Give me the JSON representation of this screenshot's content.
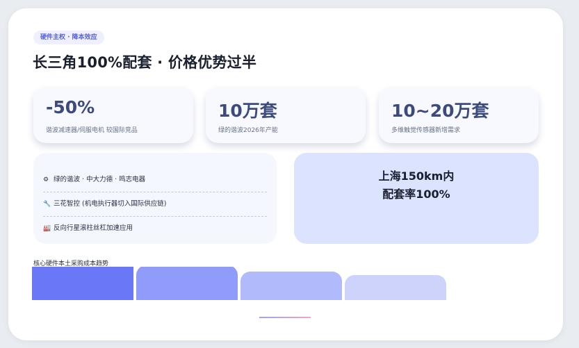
{
  "header": {
    "tag": "硬件主权 · 降本效应",
    "title": "长三角100%配套 · 价格优势过半"
  },
  "stats": [
    {
      "value": "-50%",
      "desc": "谐波减速器/伺服电机 较国际竞品"
    },
    {
      "value": "10万套",
      "desc": "绿的谐波2026年产能"
    },
    {
      "value": "10~20万套",
      "desc": "多维触觉传感器新增需求"
    }
  ],
  "bullets": [
    {
      "icon": "gear-icon",
      "glyph": "⚙",
      "text": "绿的谐波 · 中大力德 · 鸣志电器"
    },
    {
      "icon": "tool-icon",
      "glyph": "🔧",
      "text": "三花智控 (机电执行器切入国际供应链)"
    },
    {
      "icon": "factory-icon",
      "glyph": "🏭",
      "text": "反向行星滚柱丝杠加速应用"
    }
  ],
  "highlight": {
    "line1": "上海150km内",
    "line2": "配套率100%"
  },
  "chart_data": {
    "type": "bar",
    "title": "核心硬件本土采购成本趋势",
    "categories": [],
    "values": [
      100,
      88,
      76,
      70
    ],
    "colors": [
      "#6a78f8",
      "#8f9cfa",
      "#b1bafb",
      "#ced3fc"
    ]
  },
  "colors": {
    "accent": "#5561d6",
    "highlight_bg": "#dbe3ff",
    "stat_value": "#3c4a7c"
  }
}
